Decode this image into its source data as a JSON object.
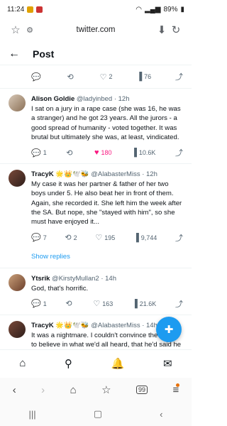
{
  "status": {
    "time": "11:24",
    "battery": "89%"
  },
  "browser": {
    "url": "twitter.com"
  },
  "header": {
    "back": "←",
    "title": "Post"
  },
  "top_actions": {
    "replies": "",
    "retweets": "",
    "likes": "2",
    "views": "76"
  },
  "tweets": [
    {
      "name": "Alison Goldie",
      "handle": "@ladyinbed · 12h",
      "text": "I sat on a jury in a rape case (she was 16, he was a stranger) and he got 23 years. All the jurors - a good spread of humanity - voted together. It was brutal but ultimately she was, at least, vindicated.",
      "replies": "1",
      "retweets": "",
      "likes": "180",
      "views": "10.6K"
    },
    {
      "name": "TracyK 🌟👑🕊️🐝",
      "handle": "@AlabasterMiss · 12h",
      "text": "My case it was her partner & father of her two boys under 5. He also beat her in front of them. Again, she recorded it. She left him the week after the SA. But nope, she \"stayed with him\", so she must have enjoyed it...",
      "replies": "7",
      "retweets": "2",
      "likes": "195",
      "views": "9,744"
    },
    {
      "name": "Ytsrik",
      "handle": "@KirstyMullan2 · 14h",
      "text": "God, that's horrific.",
      "replies": "1",
      "retweets": "",
      "likes": "163",
      "views": "21.6K"
    },
    {
      "name": "TracyK 🌟👑🕊️🐝",
      "handle": "@AlabasterMiss · 14h",
      "text": "It was a nightmare. I couldn't convince the others to believe in what we'd all heard, that he'd said he had done it, unaware she taped everything for her own protection. They were",
      "replies": "",
      "retweets": "",
      "likes": "",
      "views": ""
    }
  ],
  "show_replies": "Show replies",
  "colors": {
    "accent": "#1d9bf0",
    "like": "#f91880",
    "muted": "#536471"
  }
}
